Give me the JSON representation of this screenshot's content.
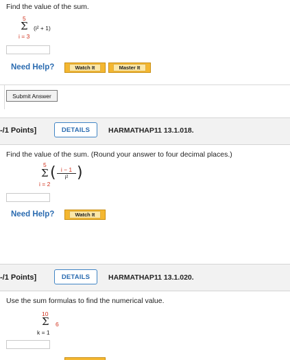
{
  "problem1": {
    "prompt": "Find the value of the sum.",
    "sum_upper": "5",
    "sum_symbol": "Σ",
    "sum_lower": "i = 3",
    "expression": "(i² + 1)",
    "answer_value": "",
    "need_help": "Need Help?",
    "watch_label": "Watch It",
    "master_label": "Master It",
    "submit_label": "Submit Answer"
  },
  "problem2": {
    "points": "-/1 Points]",
    "details_label": "DETAILS",
    "code": "HARMATHAP11 13.1.018.",
    "prompt": "Find the value of the sum. (Round your answer to four decimal places.)",
    "sum_upper": "5",
    "sum_symbol": "Σ",
    "sum_lower": "i = 2",
    "numerator": "i − 1",
    "denominator": "i²",
    "answer_value": "",
    "need_help": "Need Help?",
    "watch_label": "Watch It"
  },
  "problem3": {
    "points": "-/1 Points]",
    "details_label": "DETAILS",
    "code": "HARMATHAP11 13.1.020.",
    "prompt": "Use the sum formulas to find the numerical value.",
    "sum_upper": "10",
    "sum_symbol": "Σ",
    "sum_lower": "k = 1",
    "expression": "6",
    "answer_value": ""
  },
  "colors": {
    "accent_blue": "#2a6bb0",
    "highlight_red": "#d0321e",
    "button_yellow": "#f4b731",
    "band_gray": "#f2f2f2"
  }
}
